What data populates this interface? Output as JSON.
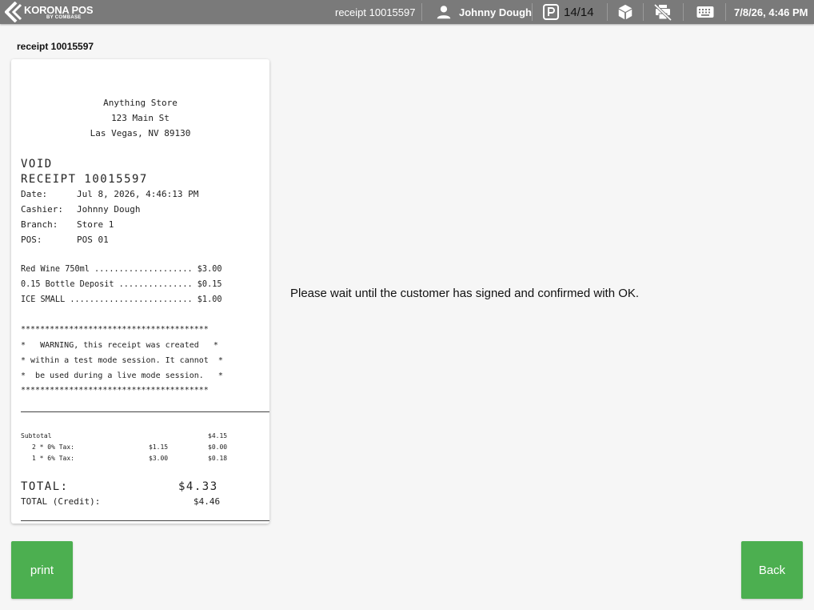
{
  "topbar": {
    "logo_main": "KORONA POS",
    "logo_sub": "BY COMBASE",
    "receipt_label": "receipt 10015597",
    "user_name": "Johnny Dough",
    "parked_count": "14/14",
    "datetime": "7/8/26, 4:46 PM"
  },
  "page": {
    "title": "receipt 10015597"
  },
  "receipt": {
    "store_name": "Anything Store",
    "address1": "123 Main St",
    "address2": "Las Vegas, NV 89130",
    "void": "VOID",
    "receipt_no": "RECEIPT 10015597",
    "date_label": "Date:",
    "date_value": "Jul 8, 2026, 4:46:13 PM",
    "cashier_label": "Cashier:",
    "cashier_value": "Johnny Dough",
    "branch_label": "Branch:",
    "branch_value": "Store 1",
    "pos_label": "POS:",
    "pos_value": "POS 01",
    "items": [
      "Red Wine 750ml .................... $3.00",
      "0.15 Bottle Deposit ............... $0.15",
      "ICE SMALL ......................... $1.00"
    ],
    "warning": [
      "***************************************",
      "*   WARNING, this receipt was created   *",
      "* within a test mode session. It cannot  *",
      "*  be used during a live mode session.   *",
      "***************************************"
    ],
    "subtotal_label": "Subtotal",
    "subtotal_value": "$4.15",
    "tax1_label": "2 * 0% Tax:",
    "tax1_base": "$1.15",
    "tax1_value": "$0.00",
    "tax2_label": "1 * 6% Tax:",
    "tax2_base": "$3.00",
    "tax2_value": "$0.18",
    "total_label": "TOTAL:",
    "total_value": "$4.33",
    "total_credit_label": "TOTAL (Credit):",
    "total_credit_value": "$4.46"
  },
  "message": "Please wait until the customer has signed and confirmed with OK.",
  "buttons": {
    "print": "print",
    "back": "Back"
  },
  "colors": {
    "topbar": "#7a7a7a",
    "button": "#4caf50"
  }
}
